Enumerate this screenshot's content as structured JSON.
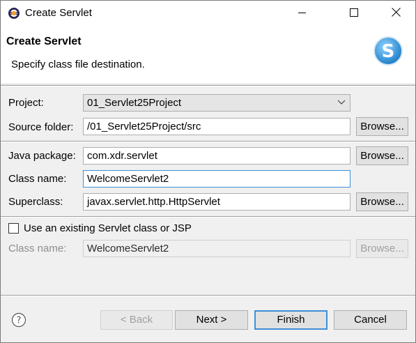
{
  "window": {
    "title": "Create Servlet"
  },
  "icons": {
    "app": "eclipse-icon",
    "minimize": "minimize-icon",
    "maximize": "maximize-icon",
    "close": "close-icon",
    "banner": "servlet-logo-icon",
    "dropdown": "chevron-down-icon",
    "help": "help-icon"
  },
  "banner": {
    "title": "Create Servlet",
    "subtitle": "Specify class file destination.",
    "logo_letter": "S"
  },
  "form": {
    "project": {
      "label": "Project:",
      "value": "01_Servlet25Project"
    },
    "source_folder": {
      "label": "Source folder:",
      "value": "/01_Servlet25Project/src",
      "browse": "Browse..."
    },
    "java_package": {
      "label": "Java package:",
      "value": "com.xdr.servlet",
      "browse": "Browse..."
    },
    "class_name": {
      "label": "Class name:",
      "value": "WelcomeServlet2"
    },
    "superclass": {
      "label": "Superclass:",
      "value": "javax.servlet.http.HttpServlet",
      "browse": "Browse..."
    },
    "use_existing": {
      "label": "Use an existing Servlet class or JSP",
      "checked": false
    },
    "existing_class": {
      "label": "Class name:",
      "value": "WelcomeServlet2",
      "browse": "Browse..."
    }
  },
  "buttons": {
    "back": "< Back",
    "next": "Next >",
    "finish": "Finish",
    "cancel": "Cancel"
  },
  "colors": {
    "focus": "#3e8fd8",
    "dialog_bg": "#f0f0f0",
    "logo": "#1e90d6"
  }
}
